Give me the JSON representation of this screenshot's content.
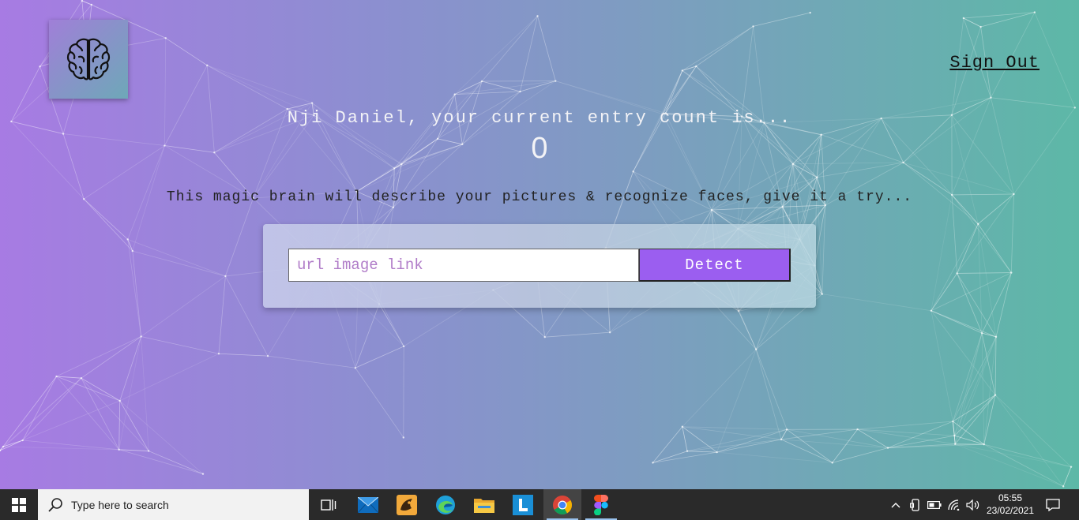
{
  "header": {
    "logo_icon": "brain-icon",
    "sign_out_label": "Sign Out"
  },
  "rank": {
    "greeting": "Nji Daniel, your current entry count is...",
    "entry_count": "0"
  },
  "form": {
    "description": "This magic brain will describe your pictures & recognize faces, give it a try...",
    "input_placeholder": "url image link",
    "input_value": "",
    "detect_label": "Detect"
  },
  "colors": {
    "gradient_left": "#a77be3",
    "gradient_right": "#5db8a7",
    "detect_button": "#9b5ef0",
    "placeholder": "#b07cc8"
  },
  "taskbar": {
    "search_placeholder": "Type here to search",
    "apps": [
      {
        "name": "task-view-icon"
      },
      {
        "name": "mail-icon"
      },
      {
        "name": "game-app-icon"
      },
      {
        "name": "edge-icon"
      },
      {
        "name": "file-explorer-icon"
      },
      {
        "name": "l-app-icon"
      },
      {
        "name": "chrome-icon",
        "active": true
      },
      {
        "name": "figma-icon",
        "open": true
      }
    ],
    "time": "05:55",
    "date": "23/02/2021"
  }
}
